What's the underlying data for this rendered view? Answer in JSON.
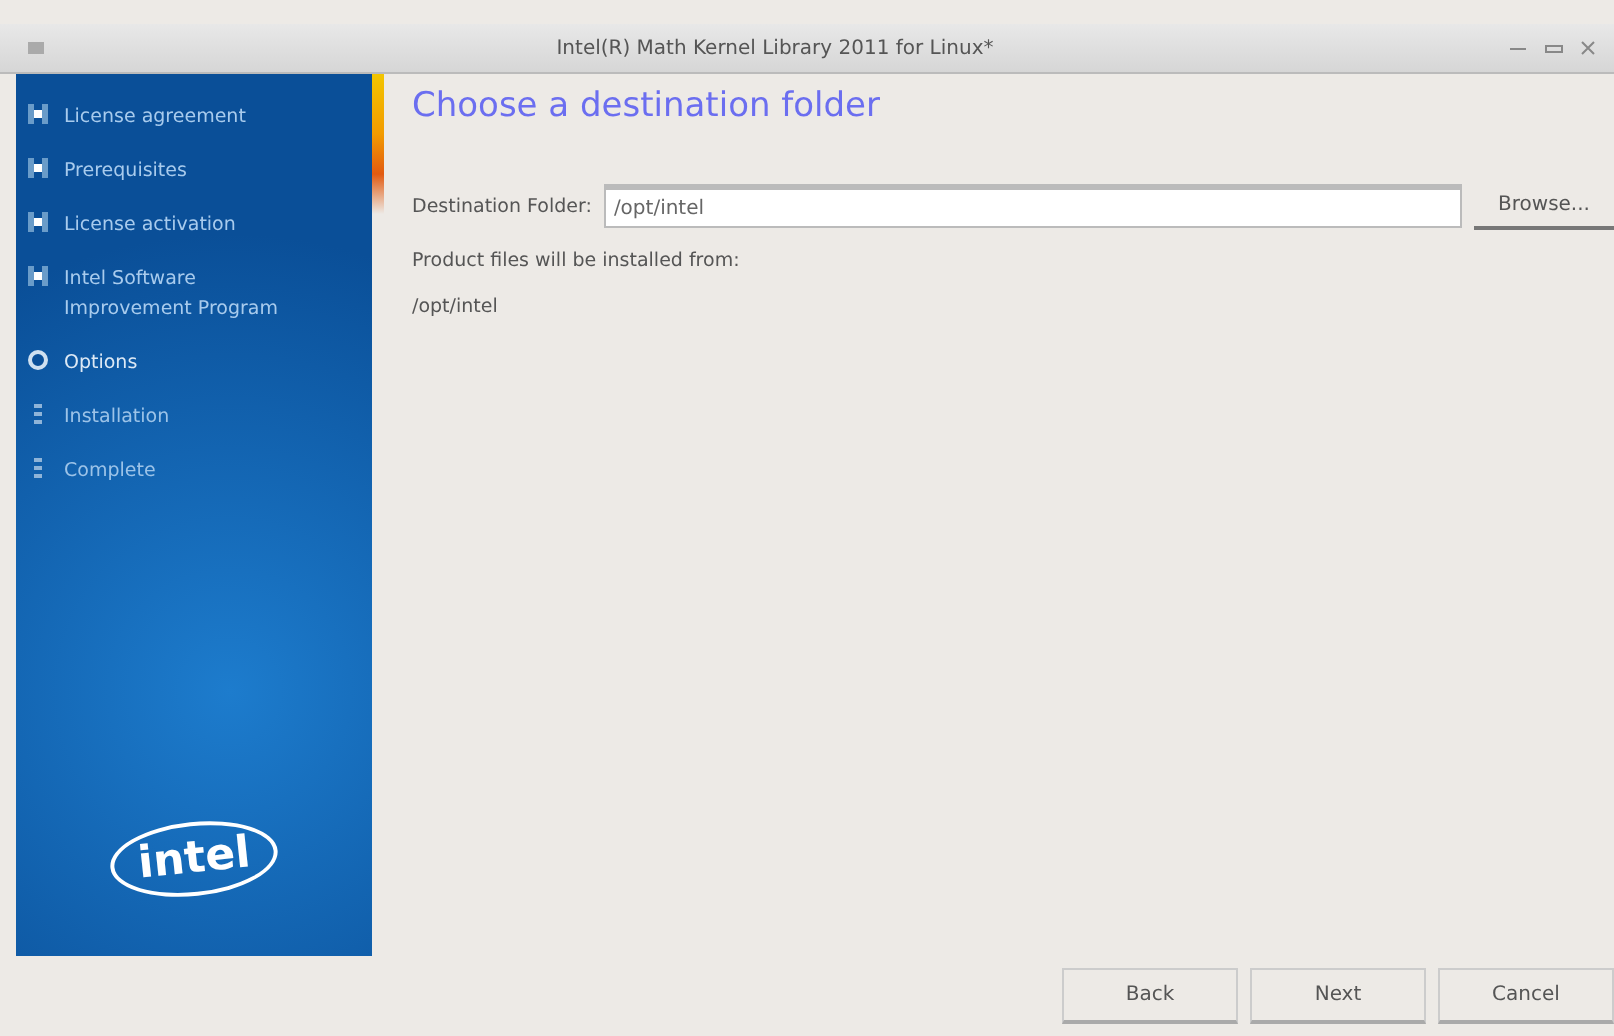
{
  "window": {
    "title": "Intel(R) Math Kernel Library 2011 for Linux*"
  },
  "steps": [
    {
      "label": "License agreement",
      "completed": true,
      "selected": false
    },
    {
      "label": "Prerequisites",
      "completed": true,
      "selected": false
    },
    {
      "label": "License activation",
      "completed": true,
      "selected": false
    },
    {
      "label": "Intel Software\nImprovement Program",
      "completed": true,
      "selected": false
    },
    {
      "label": "Options",
      "completed": false,
      "selected": true
    },
    {
      "label": "Installation",
      "completed": false,
      "selected": false
    },
    {
      "label": "Complete",
      "completed": false,
      "selected": false
    }
  ],
  "logo": {
    "text": "intel"
  },
  "page": {
    "title": "Choose a destination folder",
    "field_label": "Destination Folder:",
    "field_value": "/opt/intel",
    "browse": "Browse...",
    "note": "Product files will be installed from:",
    "path": "/opt/intel"
  },
  "buttons": [
    {
      "label": "Back"
    },
    {
      "label": "Next"
    },
    {
      "label": "Cancel"
    }
  ]
}
